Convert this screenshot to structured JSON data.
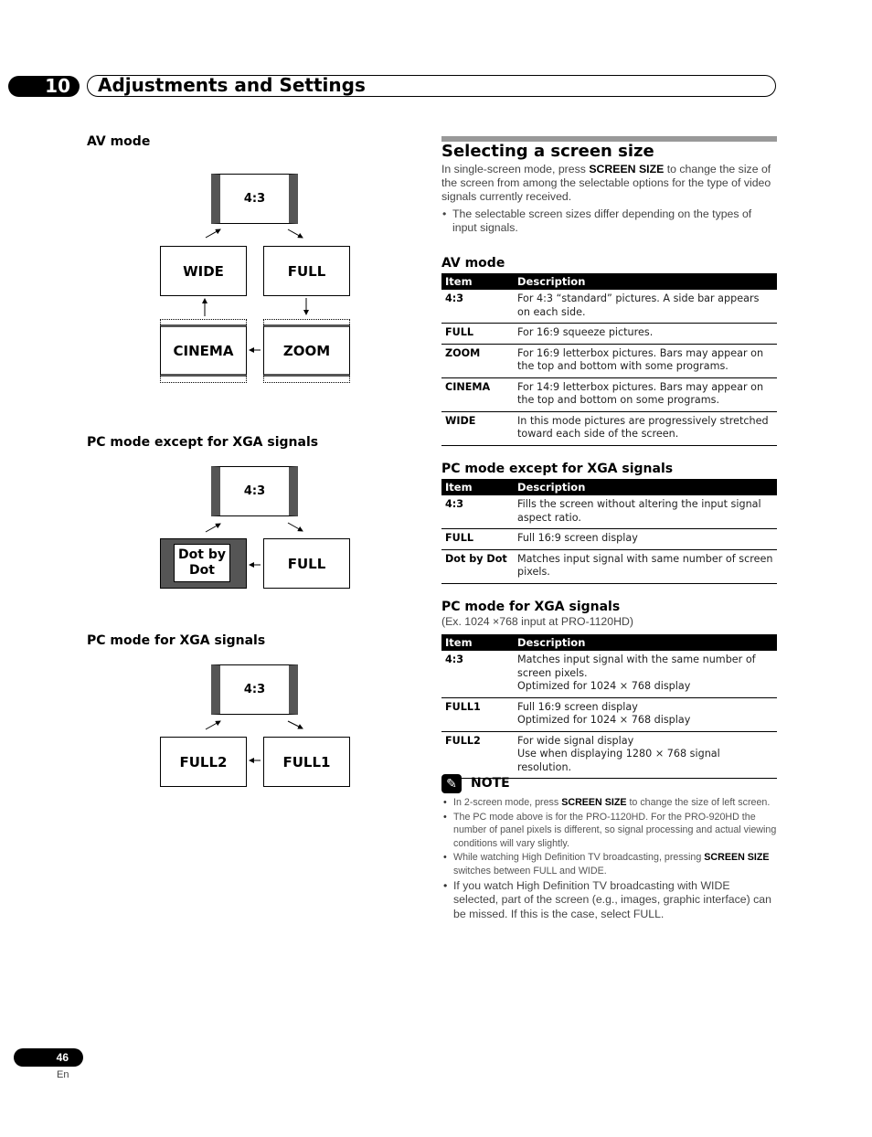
{
  "header": {
    "chapter_number": "10",
    "chapter_title": "Adjustments and Settings"
  },
  "diagrams": {
    "av_mode": {
      "heading": "AV mode",
      "screens": {
        "top": "4:3",
        "wide": "WIDE",
        "full": "FULL",
        "cinema": "CINEMA",
        "zoom": "ZOOM"
      }
    },
    "pc_except_xga": {
      "heading": "PC mode except for XGA signals",
      "screens": {
        "top": "4:3",
        "dot_by_dot_line1": "Dot by",
        "dot_by_dot_line2": "Dot",
        "full": "FULL"
      }
    },
    "pc_xga": {
      "heading": "PC mode for XGA signals",
      "screens": {
        "top": "4:3",
        "full2": "FULL2",
        "full1": "FULL1"
      }
    }
  },
  "section": {
    "title": "Selecting a screen size",
    "intro_pre": "In single-screen mode, press ",
    "intro_key": "SCREEN SIZE",
    "intro_post": " to change the size of the screen from among the selectable options for the type of video signals currently received.",
    "bullet": "The selectable screen sizes differ depending on the types of input signals."
  },
  "tables": {
    "av_mode": {
      "title": "AV mode",
      "headers": [
        "Item",
        "Description"
      ],
      "rows": [
        {
          "item": "4:3",
          "desc": "For 4:3 “standard” pictures. A side bar appears on each side."
        },
        {
          "item": "FULL",
          "desc": "For 16:9 squeeze pictures."
        },
        {
          "item": "ZOOM",
          "desc": "For 16:9 letterbox pictures. Bars may appear on the top and bottom with some programs."
        },
        {
          "item": "CINEMA",
          "desc": "For 14:9 letterbox pictures. Bars may appear on the top and bottom on some programs."
        },
        {
          "item": "WIDE",
          "desc": "In this mode pictures are progressively stretched toward each side of the screen."
        }
      ]
    },
    "pc_except_xga": {
      "title": "PC mode except for XGA signals",
      "headers": [
        "Item",
        "Description"
      ],
      "rows": [
        {
          "item": "4:3",
          "desc": "Fills the screen without altering the input signal aspect ratio."
        },
        {
          "item": "FULL",
          "desc": "Full 16:9 screen display"
        },
        {
          "item": "Dot by Dot",
          "desc": "Matches input signal with same number of screen pixels."
        }
      ]
    },
    "pc_xga": {
      "title": "PC mode for XGA signals",
      "subtitle": "(Ex. 1024 ×768 input at PRO-1120HD)",
      "headers": [
        "Item",
        "Description"
      ],
      "rows": [
        {
          "item": "4:3",
          "desc1": "Matches input signal with the same number of screen pixels.",
          "desc2": "Optimized for 1024 × 768 display"
        },
        {
          "item": "FULL1",
          "desc1": "Full 16:9 screen display",
          "desc2": "Optimized for 1024 × 768 display"
        },
        {
          "item": "FULL2",
          "desc1": "For wide signal display",
          "desc2": "Use when displaying 1280 × 768 signal resolution."
        }
      ]
    }
  },
  "note": {
    "icon": "pencil-icon",
    "label": "NOTE",
    "items": [
      {
        "pre": "In 2-screen mode, press ",
        "key": "SCREEN SIZE",
        "post": " to change the size of left screen."
      },
      {
        "pre": "The PC mode above is for the PRO-1120HD. For the PRO-920HD the number of panel pixels is different, so signal processing and actual viewing conditions will vary slightly.",
        "key": "",
        "post": ""
      },
      {
        "pre": "While watching High Definition TV broadcasting, pressing ",
        "key": "SCREEN SIZE",
        "post": " switches between FULL and WIDE."
      },
      {
        "pre": "If you watch High Definition TV broadcasting with WIDE selected, part of the screen (e.g., images, graphic interface) can be missed. If this is the case, select FULL.",
        "key": "",
        "post": ""
      }
    ]
  },
  "footer": {
    "page_number": "46",
    "language": "En"
  }
}
